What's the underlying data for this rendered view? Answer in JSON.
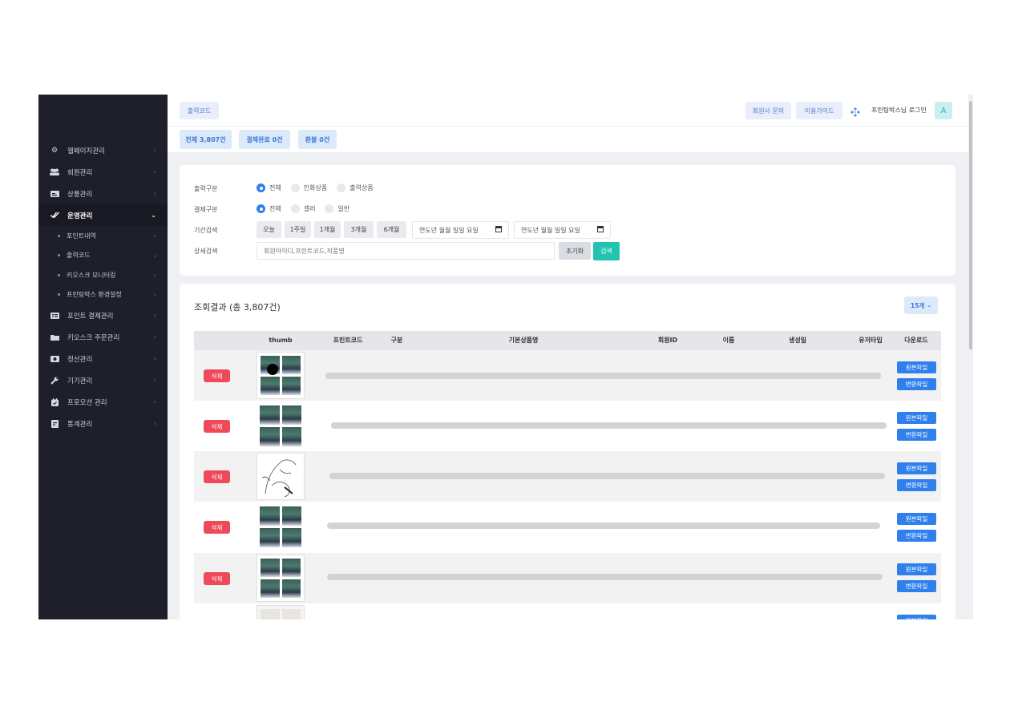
{
  "sidebar": {
    "items": [
      {
        "label": "웹페이지관리",
        "icon": "gear-icon"
      },
      {
        "label": "회원관리",
        "icon": "users-icon"
      },
      {
        "label": "상품관리",
        "icon": "product-card-icon"
      },
      {
        "label": "운영관리",
        "icon": "check-double-icon",
        "active": true
      },
      {
        "label": "포인트 결제관리",
        "icon": "list-card-icon"
      },
      {
        "label": "키오스크 주문관리",
        "icon": "folder-icon"
      },
      {
        "label": "정산관리",
        "icon": "money-icon"
      },
      {
        "label": "기기관리",
        "icon": "wrench-icon"
      },
      {
        "label": "프로모션 관리",
        "icon": "calendar-icon"
      },
      {
        "label": "통계관리",
        "icon": "report-icon"
      }
    ],
    "subitems": [
      {
        "label": "포인트내역"
      },
      {
        "label": "출력코드"
      },
      {
        "label": "키오스크 모니터링"
      },
      {
        "label": "프린팅박스 환경설정"
      }
    ]
  },
  "header": {
    "breadcrumb_label": "출력코드",
    "inquiry_label": "회원사 문의",
    "guide_label": "이용가이드",
    "user_label": "프린팅박스님 로그인",
    "avatar_letter": "A"
  },
  "tabs": [
    {
      "label": "전체 3,807건"
    },
    {
      "label": "결제완료 0건"
    },
    {
      "label": "환불 0건"
    }
  ],
  "filters": {
    "output_type": {
      "label": "출력구분",
      "options": [
        "전체",
        "인화상품",
        "출력상품"
      ],
      "selected": "전체"
    },
    "payment_type": {
      "label": "결제구분",
      "options": [
        "전체",
        "셀러",
        "일반"
      ],
      "selected": "전체"
    },
    "period": {
      "label": "기간검색",
      "buttons": [
        "오늘",
        "1주일",
        "1개월",
        "3개월",
        "6개월"
      ],
      "date_from": "연도-월-일",
      "date_to": "연도-월-일",
      "date_placeholder": "연도년 월월 일일 요일"
    },
    "detail": {
      "label": "상세검색",
      "placeholder": "회원아이디,프린트코드,작품명",
      "reset_label": "초기화",
      "search_label": "검색"
    }
  },
  "results": {
    "title": "조회결과 (총 3,807건)",
    "per_page": "15개",
    "columns": [
      "thumb",
      "프린트코드",
      "구분",
      "기본상품명",
      "회원ID",
      "이름",
      "생성일",
      "유저타입",
      "다운로드"
    ],
    "delete_label": "삭제",
    "original_label": "원본파일",
    "converted_label": "변환파일"
  },
  "colors": {
    "sidebar_bg": "#1e1f2b",
    "accent_blue": "#2f80ed",
    "accent_teal": "#22c3b1",
    "delete_red": "#ef4a5a"
  }
}
